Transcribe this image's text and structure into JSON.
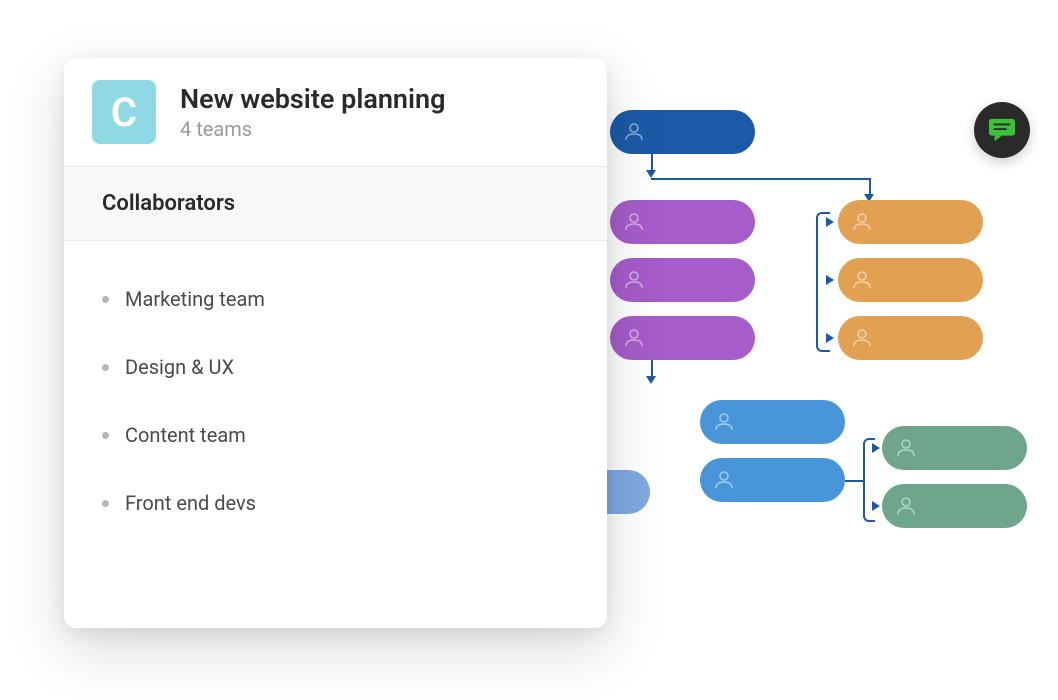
{
  "card": {
    "title": "New website planning",
    "subtitle": "4 teams",
    "app_icon_letter": "C"
  },
  "collaborators": {
    "heading": "Collaborators",
    "items": [
      "Marketing team",
      "Design & UX",
      "Content team",
      "Front end devs"
    ]
  },
  "chat": {
    "icon_name": "chat-icon"
  },
  "colors": {
    "app_icon_bg": "#8fd9e5",
    "chat_bg": "#2a2a2a",
    "chat_icon": "#3ac23a",
    "node_darkblue": "#1c5aa8",
    "node_purple": "#a65cc9",
    "node_orange": "#e2a052",
    "node_blue": "#4896d9",
    "node_lightblue": "#7fa8e0",
    "node_teal": "#6fa58c"
  }
}
